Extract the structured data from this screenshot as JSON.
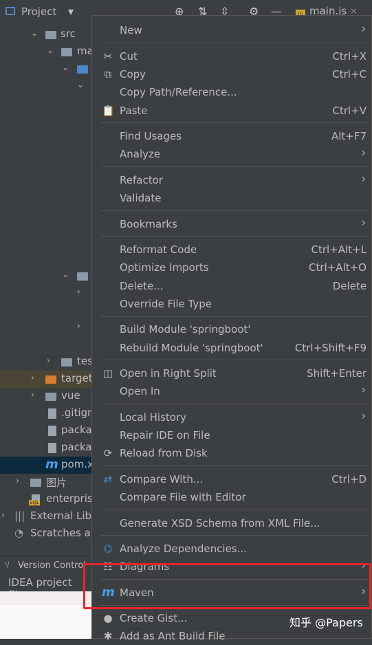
{
  "toolbar": {
    "title": "Project",
    "tab": "main.js"
  },
  "tree": {
    "rows": [
      {
        "label": "src"
      },
      {
        "label": "ma"
      },
      {
        "label": ""
      },
      {
        "label": "tes"
      },
      {
        "label": "target"
      },
      {
        "label": "vue"
      },
      {
        "label": ".gitign"
      },
      {
        "label": "packa"
      },
      {
        "label": "packa"
      },
      {
        "label": "pom.x"
      },
      {
        "label": "图片"
      },
      {
        "label": "enterpris"
      },
      {
        "label": "External Libr"
      },
      {
        "label": "Scratches an"
      }
    ]
  },
  "bottom": {
    "version_control": "Version Control",
    "status": "IDEA project files"
  },
  "menu": {
    "new": "New",
    "cut": "Cut",
    "cut_sc": "Ctrl+X",
    "copy": "Copy",
    "copy_sc": "Ctrl+C",
    "copy_path": "Copy Path/Reference...",
    "paste": "Paste",
    "paste_sc": "Ctrl+V",
    "find_usages": "Find Usages",
    "find_usages_sc": "Alt+F7",
    "analyze": "Analyze",
    "refactor": "Refactor",
    "validate": "Validate",
    "bookmarks": "Bookmarks",
    "reformat": "Reformat Code",
    "reformat_sc": "Ctrl+Alt+L",
    "optimize": "Optimize Imports",
    "optimize_sc": "Ctrl+Alt+O",
    "delete": "Delete...",
    "delete_sc": "Delete",
    "override": "Override File Type",
    "build": "Build Module 'springboot'",
    "rebuild": "Rebuild Module 'springboot'",
    "rebuild_sc": "Ctrl+Shift+F9",
    "open_right": "Open in Right Split",
    "open_right_sc": "Shift+Enter",
    "open_in": "Open In",
    "local_history": "Local History",
    "repair": "Repair IDE on File",
    "reload": "Reload from Disk",
    "compare_with": "Compare With...",
    "compare_with_sc": "Ctrl+D",
    "compare_editor": "Compare File with Editor",
    "generate_xsd": "Generate XSD Schema from XML File...",
    "analyze_deps": "Analyze Dependencies...",
    "diagrams": "Diagrams",
    "maven": "Maven",
    "create_gist": "Create Gist...",
    "ant_build": "Add as Ant Build File"
  },
  "watermark": "知乎 @Papers",
  "colors": {
    "background": "#3c3f41",
    "text": "#bbbbbb",
    "highlight_border": "#e3262b",
    "maven_icon": "#4a9eeb",
    "separator": "#555555"
  }
}
